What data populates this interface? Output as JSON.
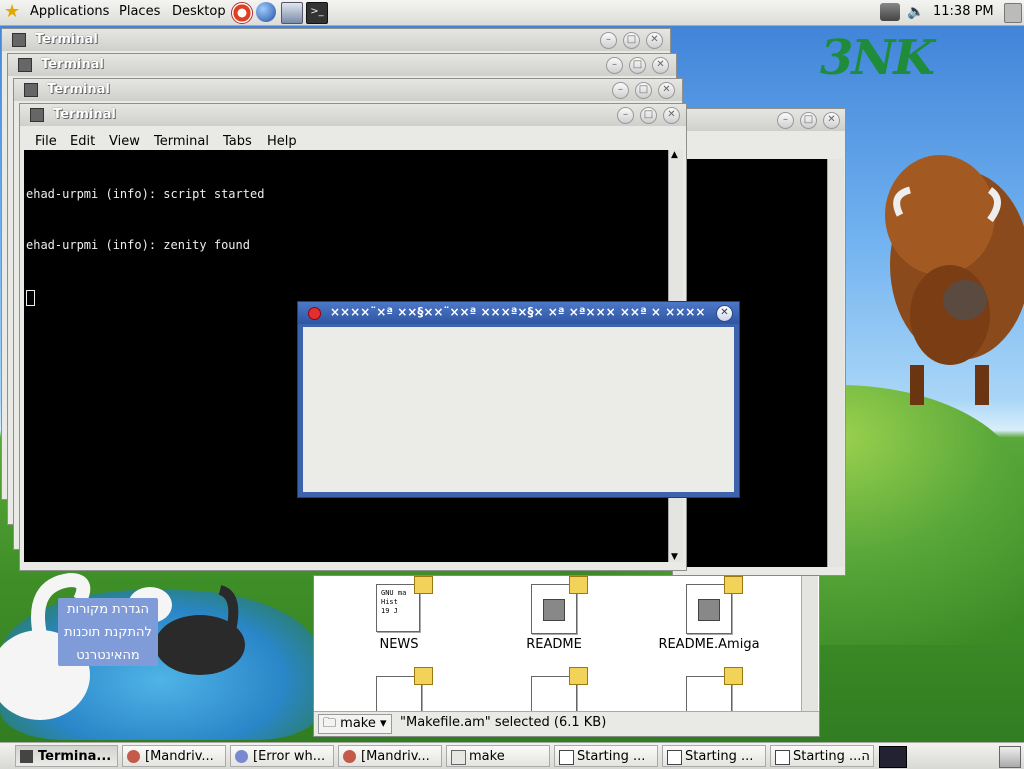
{
  "top_panel": {
    "menus": [
      "Applications",
      "Places",
      "Desktop"
    ],
    "clock": "11:38 PM"
  },
  "wallpaper": {
    "logo": "3NK",
    "tooltip_lines": [
      "הגדרת מקורות",
      "להתקנת תוכנות",
      "מהאינטרנט"
    ]
  },
  "terminals": {
    "stack_titles": [
      "Terminal",
      "Terminal",
      "Terminal",
      "Terminal"
    ],
    "menu": [
      "File",
      "Edit",
      "View",
      "Terminal",
      "Tabs",
      "Help"
    ],
    "lines": [
      "ehad-urpmi (info): script started",
      "ehad-urpmi (info): zenity found"
    ]
  },
  "dialog": {
    "title": "××××¨×ª ××§××¨××ª ×××ª×§× ×ª ×ª××× ××ª × ××××"
  },
  "file_manager": {
    "files": [
      {
        "name": "NEWS",
        "preview": "GNU ma\nHist\n19 J"
      },
      {
        "name": "README",
        "preview": ""
      },
      {
        "name": "README.Amiga",
        "preview": ""
      }
    ],
    "path_button": "make",
    "status": "\"Makefile.am\" selected (6.1 KB)"
  },
  "taskbar": {
    "tasks": [
      {
        "label": "Termina...",
        "active": true
      },
      {
        "label": "[Mandriv...",
        "active": false
      },
      {
        "label": "[Error wh...",
        "active": false
      },
      {
        "label": "[Mandriv...",
        "active": false
      },
      {
        "label": "make",
        "active": false
      },
      {
        "label": "Starting ...",
        "active": false
      },
      {
        "label": "Starting ...",
        "active": false
      },
      {
        "label": "Starting ...ה",
        "active": false
      }
    ]
  },
  "colors": {
    "dialog_title": "#2e55a3",
    "terminal_bg": "#000000",
    "terminal_fg": "#eeeeee",
    "tooltip_bg": "#7f9cd8"
  }
}
